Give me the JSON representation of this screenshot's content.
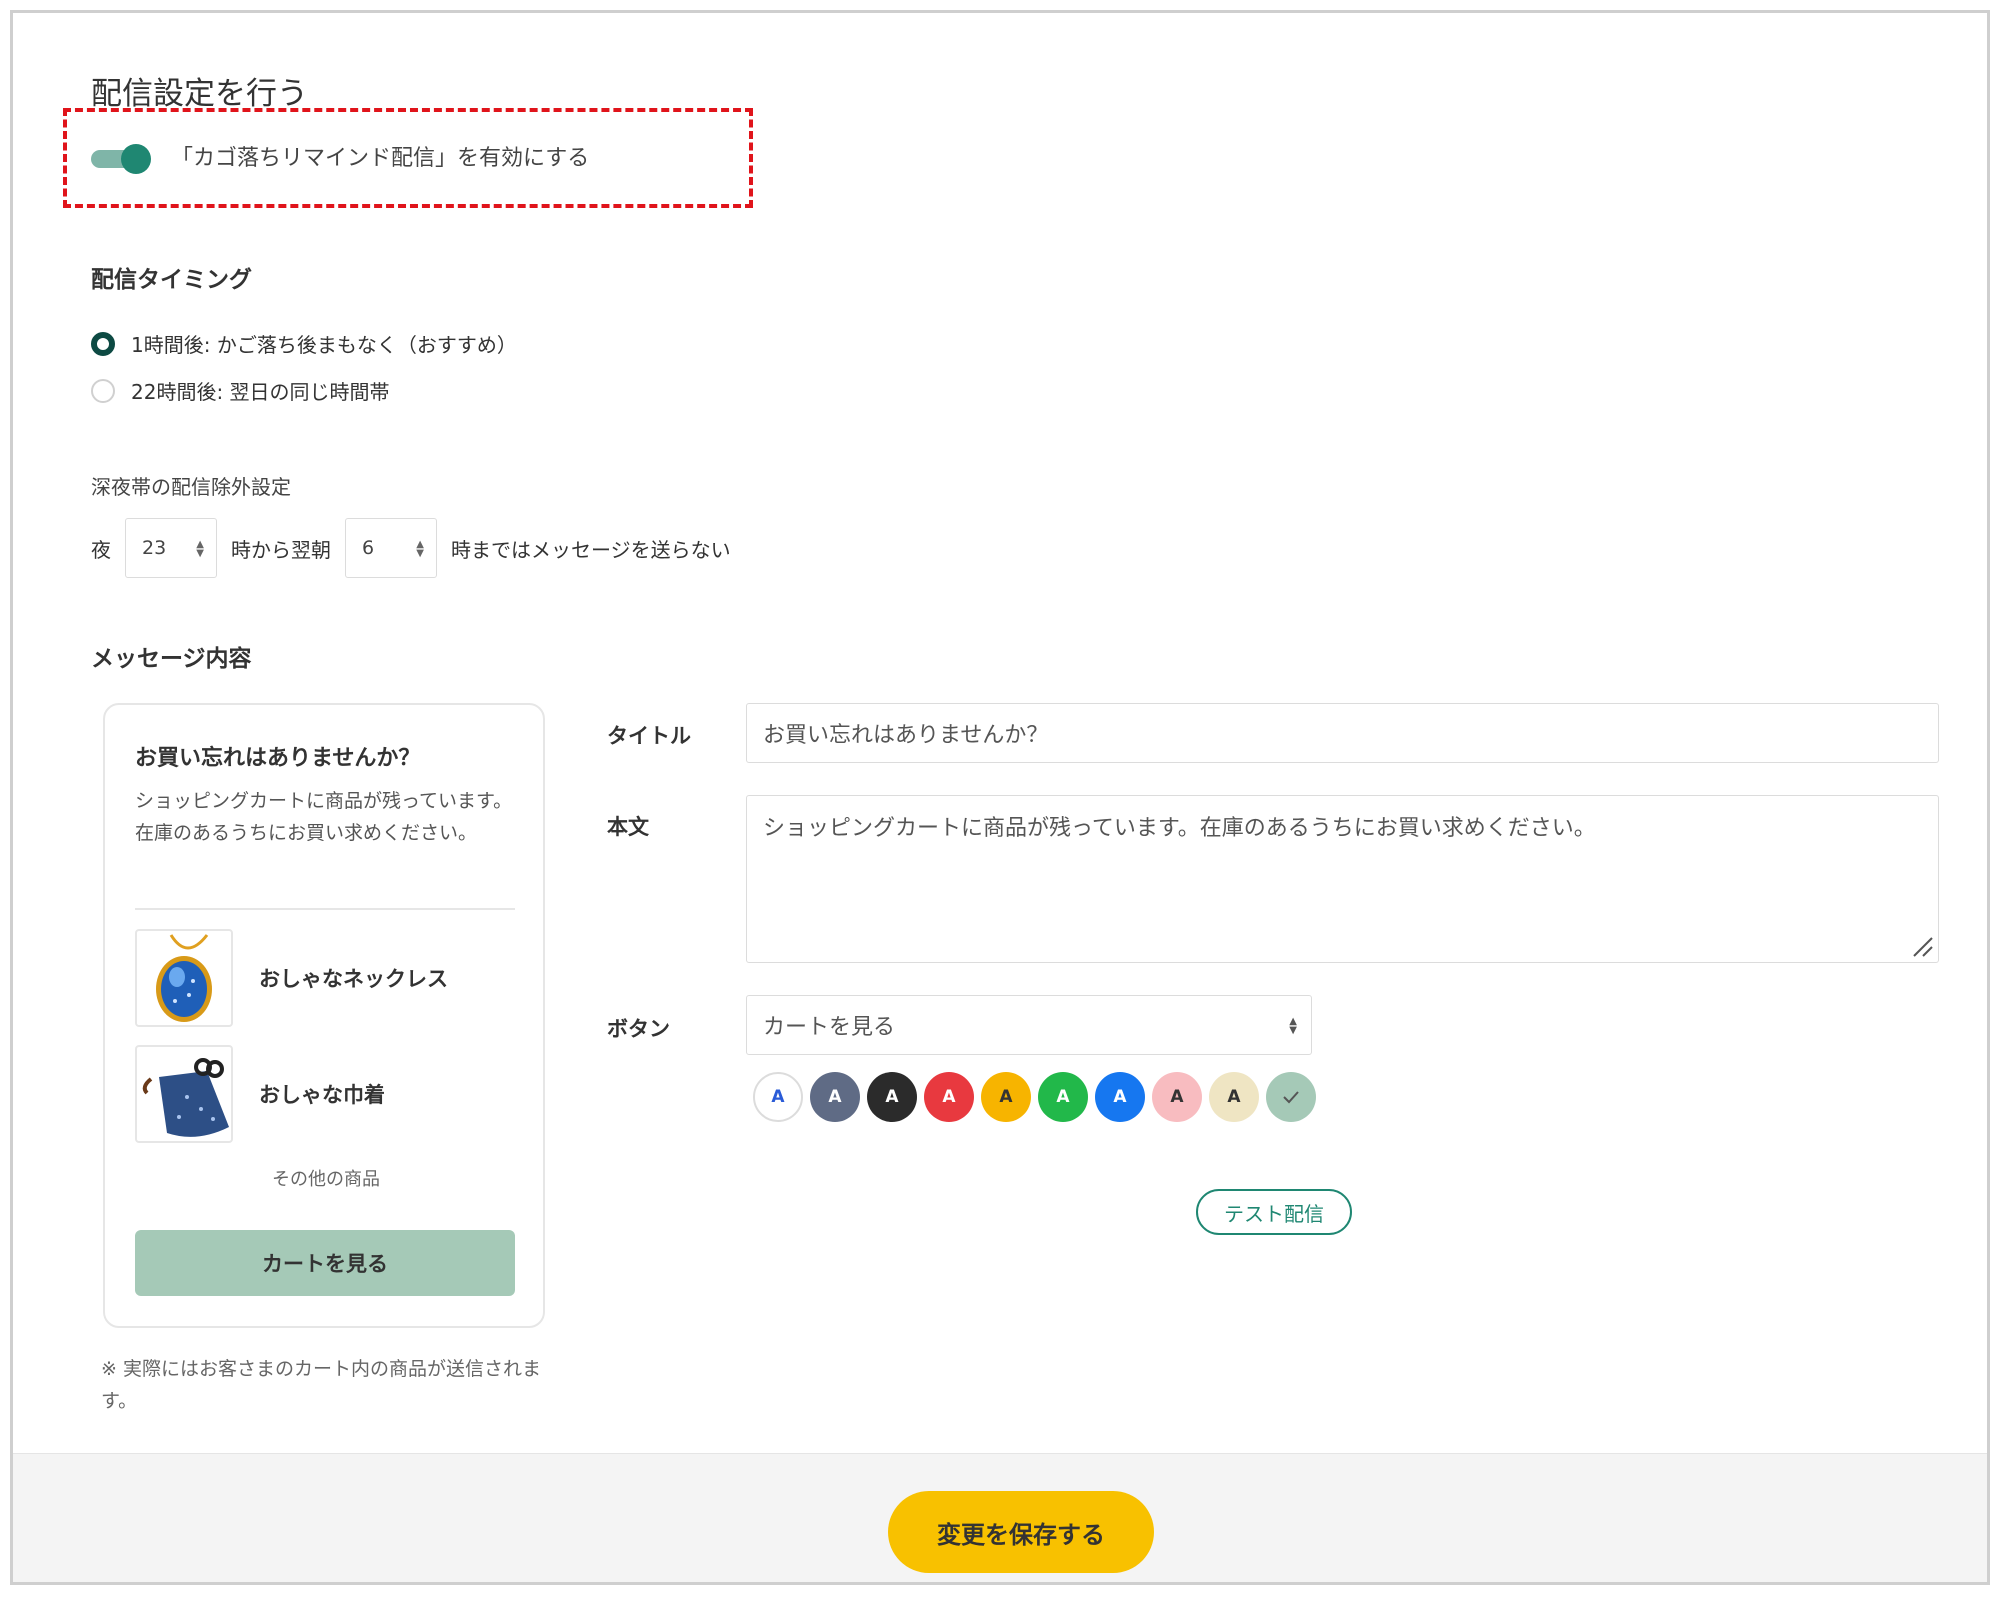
{
  "header": {
    "title": "配信設定を行う",
    "toggle_label": "「カゴ落ちリマインド配信」を有効にする",
    "toggle_on": true
  },
  "timing": {
    "heading": "配信タイミング",
    "options": [
      {
        "label": "1時間後: かご落ち後まもなく（おすすめ）",
        "checked": true
      },
      {
        "label": "22時間後: 翌日の同じ時間帯",
        "checked": false
      }
    ]
  },
  "quiet_hours": {
    "label": "深夜帯の配信除外設定",
    "prefix": "夜",
    "from_value": "23",
    "middle": "時から翌朝",
    "to_value": "6",
    "suffix": "時まではメッセージを送らない"
  },
  "message": {
    "heading": "メッセージ内容",
    "preview": {
      "title": "お買い忘れはありませんか？",
      "body": "ショッピングカートに商品が残っています。在庫のあるうちにお買い求めください。",
      "items": [
        {
          "name": "おしゃなネックレス",
          "icon": "necklace-image"
        },
        {
          "name": "おしゃな巾着",
          "icon": "pouch-image"
        }
      ],
      "more": "その他の商品",
      "button": "カートを見る",
      "note": "※ 実際にはお客さまのカート内の商品が送信されます。"
    },
    "form": {
      "title_label": "タイトル",
      "title_value": "お買い忘れはありませんか？",
      "body_label": "本文",
      "body_value": "ショッピングカートに商品が残っています。在庫のあるうちにお買い求めください。",
      "button_label": "ボタン",
      "button_value": "カートを見る",
      "swatch_letter": "A",
      "swatches": [
        {
          "bg": "#ffffff",
          "fg": "#2a5bd7",
          "selected": false
        },
        {
          "bg": "#5f6b85",
          "fg": "#ffffff",
          "selected": false
        },
        {
          "bg": "#2b2b2b",
          "fg": "#ffffff",
          "selected": false
        },
        {
          "bg": "#e8393f",
          "fg": "#ffffff",
          "selected": false
        },
        {
          "bg": "#f7b400",
          "fg": "#333333",
          "selected": false
        },
        {
          "bg": "#22b84a",
          "fg": "#ffffff",
          "selected": false
        },
        {
          "bg": "#1677f0",
          "fg": "#ffffff",
          "selected": false
        },
        {
          "bg": "#f8bcc0",
          "fg": "#333333",
          "selected": false
        },
        {
          "bg": "#efe5c3",
          "fg": "#333333",
          "selected": false
        },
        {
          "bg": "#a5c9b7",
          "fg": "#555555",
          "selected": true
        }
      ],
      "test_button": "テスト配信"
    }
  },
  "footer": {
    "save_button": "変更を保存する"
  },
  "colors": {
    "accent": "#1f8772",
    "save": "#f8c100",
    "highlight": "#e0141b"
  }
}
